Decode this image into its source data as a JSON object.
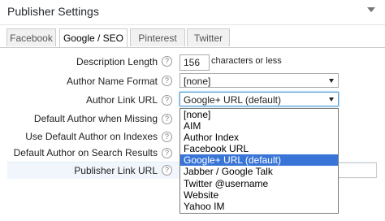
{
  "panel": {
    "title": "Publisher Settings"
  },
  "tabs": [
    {
      "label": "Facebook",
      "active": false
    },
    {
      "label": "Google / SEO",
      "active": true
    },
    {
      "label": "Pinterest",
      "active": false
    },
    {
      "label": "Twitter",
      "active": false
    }
  ],
  "fields": {
    "description_length": {
      "label": "Description Length",
      "value": "156",
      "suffix": "characters or less"
    },
    "author_name_format": {
      "label": "Author Name Format",
      "value": "[none]"
    },
    "author_link_url": {
      "label": "Author Link URL",
      "value": "Google+ URL (default)"
    },
    "default_author_when_missing": {
      "label": "Default Author when Missing"
    },
    "use_default_author_on_indexes": {
      "label": "Use Default Author on Indexes"
    },
    "default_author_on_search_results": {
      "label": "Default Author on Search Results"
    },
    "publisher_link_url": {
      "label": "Publisher Link URL",
      "value": ""
    }
  },
  "help_glyph": "?",
  "dropdown": {
    "options": [
      "[none]",
      "AIM",
      "Author Index",
      "Facebook URL",
      "Google+ URL (default)",
      "Jabber / Google Talk",
      "Twitter @username",
      "Website",
      "Yahoo IM"
    ],
    "selected_index": 4
  },
  "colors": {
    "selected_option_bg": "#3875d7",
    "focus_border": "#5b9dd9",
    "highlight_row": "#f0f6fb"
  }
}
